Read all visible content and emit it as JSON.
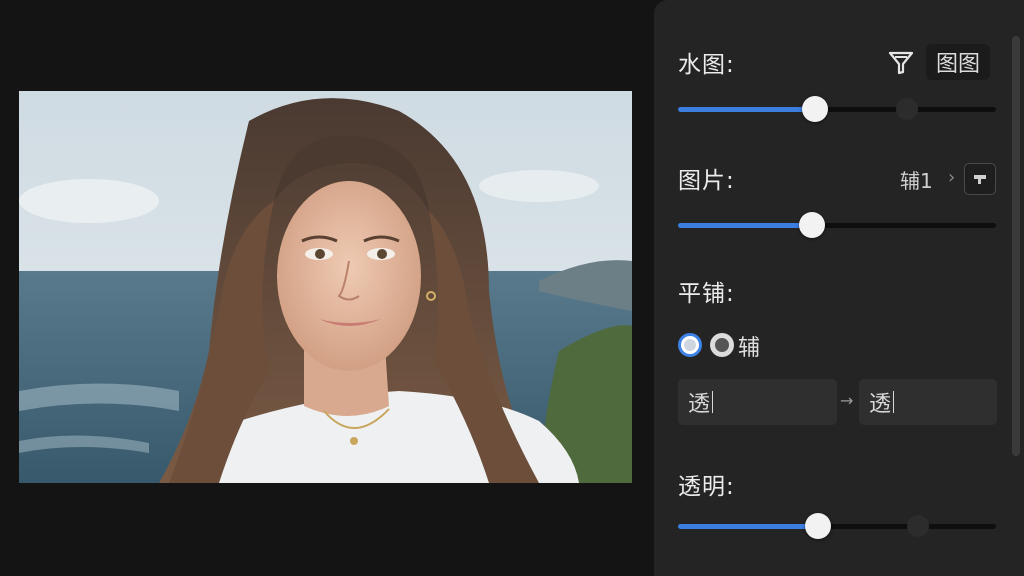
{
  "panel": {
    "watermark": {
      "label": "水图:",
      "chip_label": "图图",
      "filter_icon": "funnel-icon",
      "value": 0.43
    },
    "image": {
      "label": "图片:",
      "value_text": "辅1",
      "chevron": "›",
      "value": 0.42
    },
    "tile": {
      "label": "平铺:",
      "option_label": "辅",
      "field_from": "透",
      "arrow": "→",
      "field_to": "透"
    },
    "opacity": {
      "label": "透明:",
      "value": 0.44
    }
  },
  "colors": {
    "accent": "#3c7de0",
    "panel": "#242424",
    "background": "#141414"
  }
}
